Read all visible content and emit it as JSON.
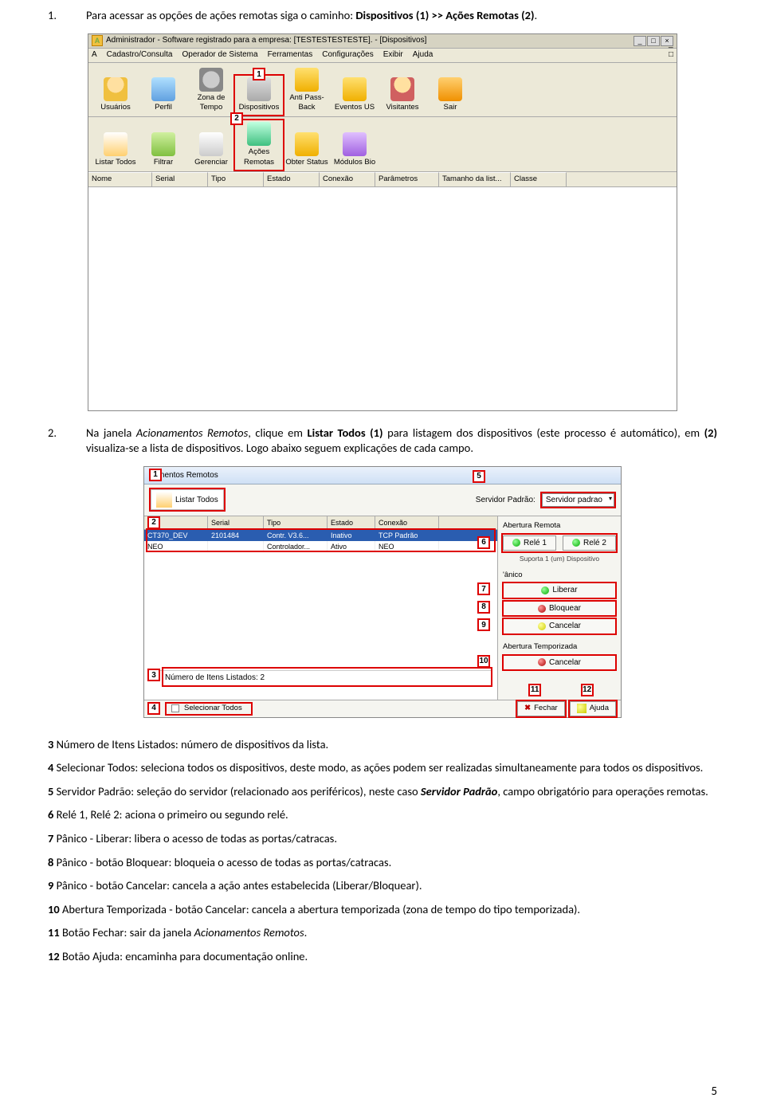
{
  "step1": {
    "num": "1.",
    "prefix": "Para acessar as opções de ações remotas siga o caminho: ",
    "bold": "Dispositivos (1) >> Ações Remotas (2)",
    "suffix": "."
  },
  "shot1": {
    "title": "Administrador - Software registrado para a empresa: [TESTESTESTESTE]. - [Dispositivos]",
    "menus": [
      "Cadastro/Consulta",
      "Operador de Sistema",
      "Ferramentas",
      "Configurações",
      "Exibir",
      "Ajuda"
    ],
    "toolbar1": [
      "Usuários",
      "Perfil",
      "Zona de Tempo",
      "Dispositivos",
      "Anti Pass-Back",
      "Eventos US",
      "Visitantes",
      "Sair"
    ],
    "toolbar2": [
      "Listar Todos",
      "Filtrar",
      "Gerenciar",
      "Ações Remotas",
      "Obter Status",
      "Módulos Bio"
    ],
    "columns": [
      "Nome",
      "Serial",
      "Tipo",
      "Estado",
      "Conexão",
      "Parâmetros",
      "Tamanho da list...",
      "Classe"
    ],
    "badge1": "1",
    "badge2": "2"
  },
  "step2": {
    "num": "2.",
    "t1": "Na janela ",
    "i1": "Acionamentos Remotos",
    "t2": ", clique em ",
    "b1": "Listar Todos (1) ",
    "t3": "para listagem dos dispositivos (este processo é automático), em ",
    "b2": "(2) ",
    "t4": "visualiza-se a lista de dispositivos. Logo abaixo seguem explicações de cada campo."
  },
  "shot2": {
    "title": "namentos Remotos",
    "listar_todos": "Listar Todos",
    "serv_padrao_lbl": "Servidor Padrão:",
    "serv_padrao_val": "Servidor padrao",
    "cols": [
      "me",
      "Serial",
      "Tipo",
      "Estado",
      "Conexão"
    ],
    "row1": [
      "CT370_DEV",
      "2101484",
      "Contr. V3.6...",
      "Inativo",
      "TCP Padrão"
    ],
    "row2": [
      "NEO",
      "",
      "Controlador...",
      "Ativo",
      "NEO"
    ],
    "ab_remota": "Abertura Remota",
    "rele1": "Relé 1",
    "rele2": "Relé 2",
    "support": "Suporta 1 (um) Dispositivo",
    "panico": "'ânico",
    "liberar": "Liberar",
    "bloquear": "Bloquear",
    "cancelar": "Cancelar",
    "ab_temp": "Abertura Temporizada",
    "cancelar2": "Cancelar",
    "num_itens": "Número de Itens Listados: 2",
    "sel_todos": "Selecionar Todos",
    "fechar": "Fechar",
    "ajuda": "Ajuda",
    "b1": "1",
    "b2": "2",
    "b3": "3",
    "b4": "4",
    "b5": "5",
    "b6": "6",
    "b7": "7",
    "b8": "8",
    "b9": "9",
    "b10": "10",
    "b11": "11",
    "b12": "12"
  },
  "descs": {
    "d3": {
      "b": "3",
      "t": " Número de Itens Listados: número de dispositivos da lista."
    },
    "d4": {
      "b": "4",
      "t": " Selecionar Todos: seleciona todos os dispositivos, deste modo, as ações podem ser realizadas simultaneamente para todos os dispositivos."
    },
    "d5": {
      "b": "5",
      "p1": " Servidor Padrão: seleção do servidor (relacionado aos periféricos), neste caso ",
      "bi": "Servidor Padrão",
      "p2": ", campo obrigatório para operações remotas."
    },
    "d6": {
      "b": "6",
      "t": " Relé 1, Relé 2: aciona o primeiro ou segundo relé."
    },
    "d7": {
      "b": "7",
      "t": " Pânico - Liberar: libera o acesso de todas as portas/catracas."
    },
    "d8": {
      "b": "8",
      "t": " Pânico - botão Bloquear: bloqueia o acesso de todas as portas/catracas."
    },
    "d9": {
      "b": "9",
      "t": " Pânico - botão Cancelar: cancela a ação antes estabelecida (Liberar/Bloquear)."
    },
    "d10": {
      "b": "10",
      "t": " Abertura Temporizada - botão Cancelar: cancela a abertura temporizada (zona de tempo do tipo temporizada)."
    },
    "d11": {
      "b": "11",
      "p1": " Botão Fechar: sair da janela ",
      "i": "Acionamentos Remotos",
      "p2": "."
    },
    "d12": {
      "b": "12",
      "t": " Botão Ajuda:  encaminha para documentação online."
    }
  },
  "page_num": "5"
}
